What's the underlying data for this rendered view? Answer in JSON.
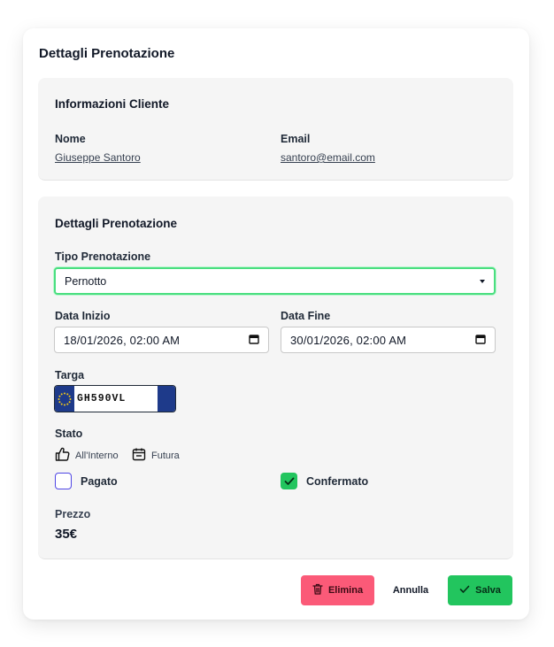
{
  "modal": {
    "title": "Dettagli Prenotazione"
  },
  "client": {
    "title": "Informazioni Cliente",
    "name_label": "Nome",
    "name_value": "Giuseppe Santoro",
    "email_label": "Email",
    "email_value": "santoro@email.com"
  },
  "booking": {
    "title": "Dettagli Prenotazione",
    "type_label": "Tipo Prenotazione",
    "type_value": "Pernotto",
    "start_label": "Data Inizio",
    "start_value": "18/01/2026, 02:00 AM",
    "end_label": "Data Fine",
    "end_value": "30/01/2026, 02:00 AM",
    "plate_label": "Targa",
    "plate_value": "GH590VL",
    "status_label": "Stato",
    "status_location": "All'Interno",
    "status_timing": "Futura",
    "paid_label": "Pagato",
    "paid_checked": false,
    "confirmed_label": "Confermato",
    "confirmed_checked": true,
    "price_label": "Prezzo",
    "price_value": "35€"
  },
  "actions": {
    "delete_label": "Elimina",
    "cancel_label": "Annulla",
    "save_label": "Salva"
  },
  "colors": {
    "accent_green": "#22c55e",
    "danger_pink": "#fb5a78",
    "select_border": "#4ade80",
    "checkbox_outline": "#4f46e5",
    "plate_blue": "#1e3a8a"
  }
}
